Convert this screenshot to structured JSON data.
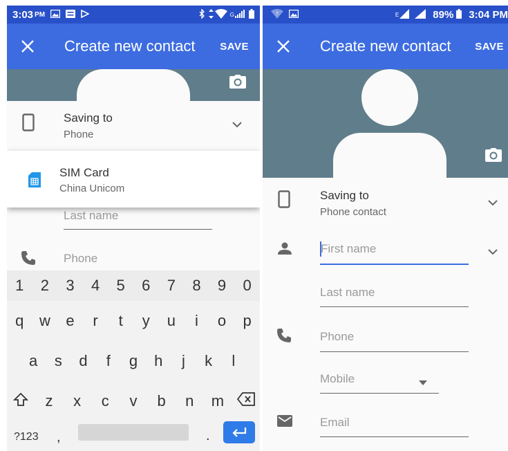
{
  "left": {
    "status": {
      "time": "3:03",
      "ampm": "PM",
      "network": "G"
    },
    "appbar": {
      "title": "Create new contact",
      "save": "SAVE"
    },
    "saving": {
      "label": "Saving to",
      "value": "Phone"
    },
    "popup": {
      "title": "SIM Card",
      "subtitle": "China Unicom"
    },
    "fields": {
      "last_name": "Last name",
      "phone": "Phone"
    },
    "keyboard": {
      "numbers": [
        "1",
        "2",
        "3",
        "4",
        "5",
        "6",
        "7",
        "8",
        "9",
        "0"
      ],
      "row1": [
        "q",
        "w",
        "e",
        "r",
        "t",
        "y",
        "u",
        "i",
        "o",
        "p"
      ],
      "row2": [
        "a",
        "s",
        "d",
        "f",
        "g",
        "h",
        "j",
        "k",
        "l"
      ],
      "row3": [
        "z",
        "x",
        "c",
        "v",
        "b",
        "n",
        "m"
      ],
      "symbols": "?123",
      "comma": ",",
      "period": "."
    }
  },
  "right": {
    "status": {
      "battery": "89%",
      "time": "3:04 PM",
      "network": "E"
    },
    "appbar": {
      "title": "Create new contact",
      "save": "SAVE"
    },
    "saving": {
      "label": "Saving to",
      "value": "Phone contact"
    },
    "fields": {
      "first_name": "First name",
      "last_name": "Last name",
      "phone": "Phone",
      "phone_type": "Mobile",
      "email": "Email"
    }
  },
  "colors": {
    "statusbar": "#2850c8",
    "appbar": "#3d6ce0",
    "photo_bg": "#607d8b",
    "accent": "#3d6ce0",
    "enter_key": "#2f7be8"
  }
}
